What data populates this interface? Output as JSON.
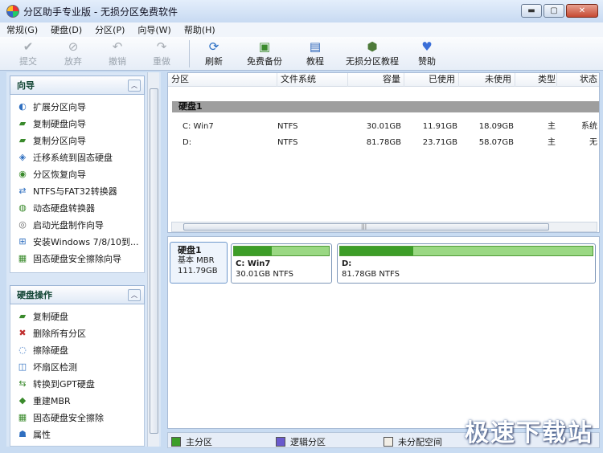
{
  "window": {
    "title": "分区助手专业版 - 无损分区免费软件",
    "minimize": "▬",
    "maximize": "▢",
    "close": "✕"
  },
  "menu": [
    "常规(G)",
    "硬盘(D)",
    "分区(P)",
    "向导(W)",
    "帮助(H)"
  ],
  "toolbar": [
    {
      "label": "提交",
      "icon": "check-icon",
      "glyph": "✔",
      "enabled": false
    },
    {
      "label": "放弃",
      "icon": "discard-icon",
      "glyph": "⊘",
      "enabled": false
    },
    {
      "label": "撤销",
      "icon": "undo-icon",
      "glyph": "↶",
      "enabled": false
    },
    {
      "label": "重做",
      "icon": "redo-icon",
      "glyph": "↷",
      "enabled": false
    },
    {
      "label": "刷新",
      "icon": "refresh-icon",
      "glyph": "⟳",
      "enabled": true
    },
    {
      "label": "免费备份",
      "icon": "backup-icon",
      "glyph": "▣",
      "enabled": true
    },
    {
      "label": "教程",
      "icon": "tutorial-icon",
      "glyph": "▤",
      "enabled": true
    },
    {
      "label": "无损分区教程",
      "icon": "lossless-tutorial-icon",
      "glyph": "⬢",
      "enabled": true
    },
    {
      "label": "赞助",
      "icon": "heart-icon",
      "glyph": "♥",
      "enabled": true
    }
  ],
  "wizards": {
    "title": "向导",
    "items": [
      "扩展分区向导",
      "复制硬盘向导",
      "复制分区向导",
      "迁移系统到固态硬盘",
      "分区恢复向导",
      "NTFS与FAT32转换器",
      "动态硬盘转换器",
      "启动光盘制作向导",
      "安装Windows 7/8/10到...",
      "固态硬盘安全擦除向导"
    ]
  },
  "disk_ops": {
    "title": "硬盘操作",
    "items": [
      "复制硬盘",
      "删除所有分区",
      "擦除硬盘",
      "坏扇区检测",
      "转换到GPT硬盘",
      "重建MBR",
      "固态硬盘安全擦除",
      "属性"
    ]
  },
  "table": {
    "columns": [
      "分区",
      "文件系统",
      "容量",
      "已使用",
      "未使用",
      "类型",
      "状态"
    ],
    "disk_label": "硬盘1",
    "rows": [
      {
        "name": "C: Win7",
        "fs": "NTFS",
        "capacity": "30.01GB",
        "used": "11.91GB",
        "free": "18.09GB",
        "type": "主",
        "status": "系统"
      },
      {
        "name": "D:",
        "fs": "NTFS",
        "capacity": "81.78GB",
        "used": "23.71GB",
        "free": "58.07GB",
        "type": "主",
        "status": "无"
      }
    ]
  },
  "diskmap": {
    "disk_name": "硬盘1",
    "disk_type": "基本 MBR",
    "disk_size": "111.79GB",
    "partitions": [
      {
        "name": "C: Win7",
        "desc": "30.01GB NTFS",
        "used_fraction": 0.4
      },
      {
        "name": "D:",
        "desc": "81.78GB NTFS",
        "used_fraction": 0.29
      }
    ]
  },
  "legend": [
    {
      "label": "主分区",
      "color": "#3d9e28"
    },
    {
      "label": "逻辑分区",
      "color": "#6a5acd"
    },
    {
      "label": "未分配空间",
      "color": "#f2eee6"
    }
  ],
  "watermark": "极速下载站"
}
